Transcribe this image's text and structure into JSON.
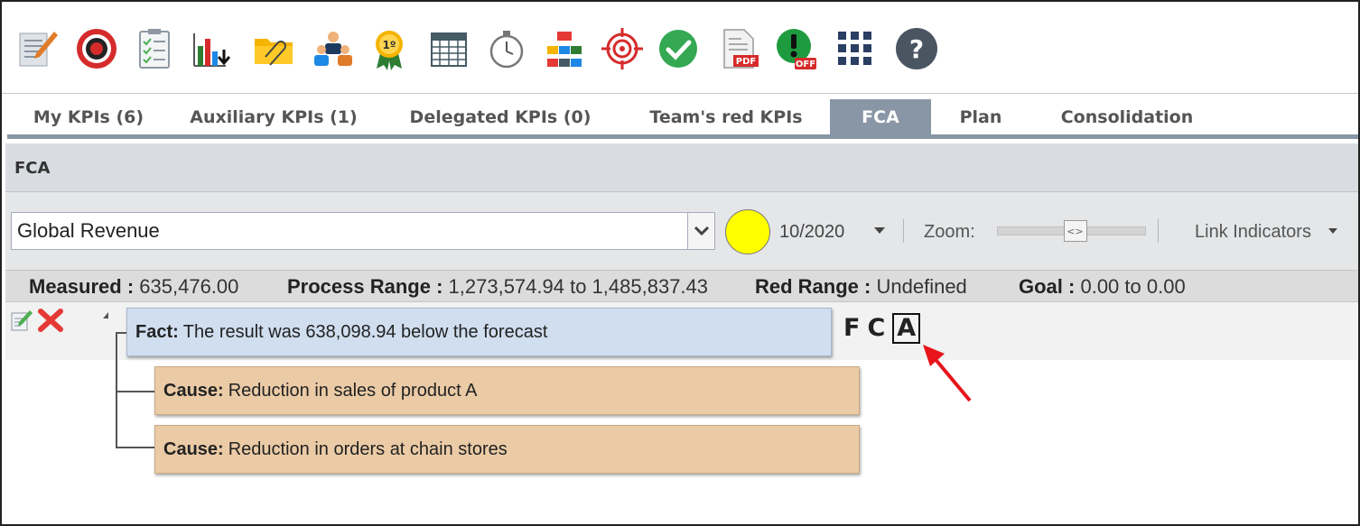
{
  "toolbar": {
    "icons": [
      {
        "name": "notes-edit-icon",
        "color": "#e07b2a"
      },
      {
        "name": "target-icon",
        "color": "#d62b2b"
      },
      {
        "name": "checklist-icon",
        "color": "#4caf50"
      },
      {
        "name": "bar-chart-download-icon",
        "color": "#2e7d32"
      },
      {
        "name": "folder-attachment-icon",
        "color": "#f5b400"
      },
      {
        "name": "team-icon",
        "color": "#1e88e5"
      },
      {
        "name": "first-place-ribbon-icon",
        "color": "#f5b400"
      },
      {
        "name": "calendar-icon",
        "color": "#455a64"
      },
      {
        "name": "stopwatch-icon",
        "color": "#666666"
      },
      {
        "name": "org-chart-icon",
        "color": "#e53935"
      },
      {
        "name": "crosshair-icon",
        "color": "#d62b2b"
      },
      {
        "name": "check-circle-icon",
        "color": "#34a853"
      },
      {
        "name": "pdf-icon",
        "color": "#d62b2b"
      },
      {
        "name": "alert-off-icon",
        "color": "#1e9b3f"
      },
      {
        "name": "apps-grid-icon",
        "color": "#2b3e63"
      },
      {
        "name": "help-icon",
        "color": "#4a5562"
      }
    ],
    "pdf_badge": "PDF",
    "off_badge": "OFF",
    "ribbon_text": "1º",
    "help_glyph": "?"
  },
  "tabs": [
    {
      "label": "My KPIs (6)",
      "active": false
    },
    {
      "label": "Auxiliary KPIs (1)",
      "active": false
    },
    {
      "label": "Delegated KPIs (0)",
      "active": false
    },
    {
      "label": "Team's red KPIs",
      "active": false
    },
    {
      "label": "FCA",
      "active": true
    },
    {
      "label": "Plan",
      "active": false
    },
    {
      "label": "Consolidation",
      "active": false
    }
  ],
  "section": {
    "title": "FCA"
  },
  "filters": {
    "indicator": "Global Revenue",
    "status_color": "#ffff00",
    "period": "10/2020",
    "zoom_label": "Zoom:",
    "zoom_level": 0.5,
    "link_label": "Link Indicators"
  },
  "measures": {
    "measured_label": "Measured :",
    "measured_value": "635,476.00",
    "process_range_label": "Process Range :",
    "process_range_value": "1,273,574.94 to 1,485,837.43",
    "red_range_label": "Red Range :",
    "red_range_value": "Undefined",
    "goal_label": "Goal :",
    "goal_value": "0.00 to 0.00"
  },
  "fca_tree": {
    "fact": {
      "kind": "Fact:",
      "text": "The result was 638,098.94 below the forecast"
    },
    "causes": [
      {
        "kind": "Cause:",
        "text": "Reduction in sales of product A"
      },
      {
        "kind": "Cause:",
        "text": "Reduction in orders at chain stores"
      }
    ],
    "letters": {
      "f": "F",
      "c": "C",
      "a": "A"
    }
  },
  "annotation": {
    "arrow_color": "#e8141c"
  }
}
